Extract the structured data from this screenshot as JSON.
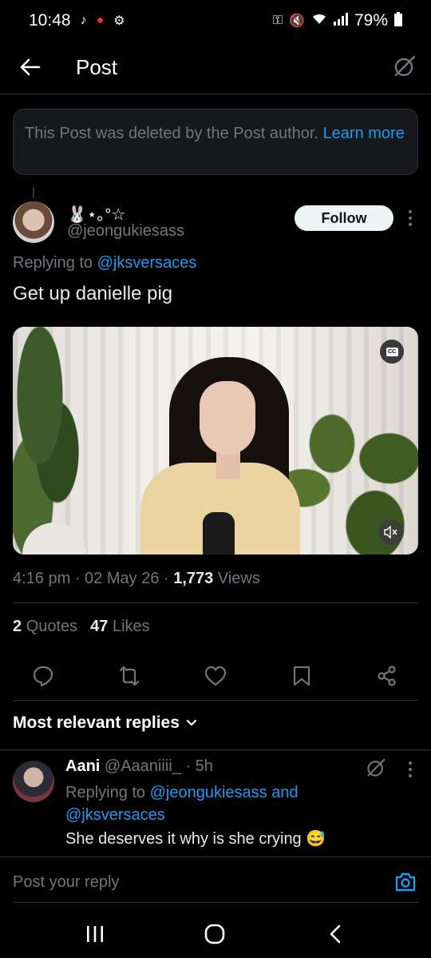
{
  "status_bar": {
    "time": "10:48",
    "battery": "79%",
    "left_icons": [
      "tiktok-icon",
      "notification-app-icon",
      "settings-icon"
    ],
    "right_icons": [
      "key-icon",
      "mute-icon",
      "wifi-icon",
      "signal-icon",
      "battery-icon"
    ]
  },
  "header": {
    "title": "Post"
  },
  "deleted_notice": {
    "text": "This Post was deleted by the Post author.",
    "link": "Learn more"
  },
  "post": {
    "display_name": "🐰⋆｡°☆",
    "handle": "@jeongukiesass",
    "follow_label": "Follow",
    "replying_prefix": "Replying to",
    "replying_to": "@jksversaces",
    "text": "Get up danielle pig",
    "time": "4:16 pm",
    "date": "02 May 26",
    "views_count": "1,773",
    "views_label": "Views",
    "quotes_count": "2",
    "quotes_label": "Quotes",
    "likes_count": "47",
    "likes_label": "Likes",
    "cc_label": "CC"
  },
  "replies": {
    "sort_label": "Most relevant replies",
    "items": [
      {
        "name": "Aani",
        "handle": "@Aaaniiii_",
        "time": "· 5h",
        "replying_prefix": "Replying to",
        "replying_to": "@jeongukiesass and @jksversaces",
        "text": "She deserves it why is she crying 😅"
      }
    ]
  },
  "compose": {
    "placeholder": "Post your reply"
  },
  "colors": {
    "accent": "#1d9bf0",
    "background": "#000000",
    "muted": "#71767b"
  }
}
